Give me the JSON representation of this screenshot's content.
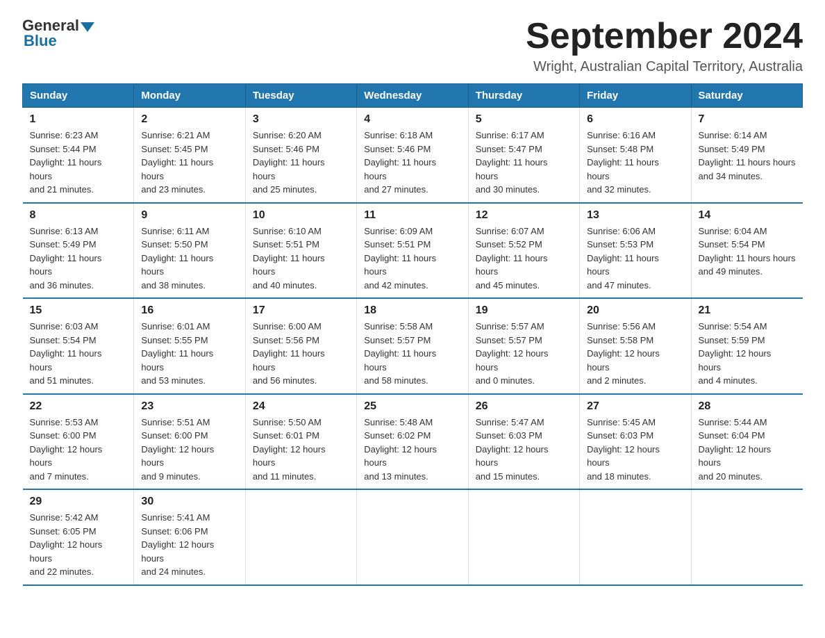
{
  "logo": {
    "general": "General",
    "blue": "Blue",
    "subtitle": "Blue"
  },
  "header": {
    "month_year": "September 2024",
    "location": "Wright, Australian Capital Territory, Australia"
  },
  "days_of_week": [
    "Sunday",
    "Monday",
    "Tuesday",
    "Wednesday",
    "Thursday",
    "Friday",
    "Saturday"
  ],
  "weeks": [
    [
      {
        "day": "1",
        "sunrise": "6:23 AM",
        "sunset": "5:44 PM",
        "daylight": "11 hours and 21 minutes."
      },
      {
        "day": "2",
        "sunrise": "6:21 AM",
        "sunset": "5:45 PM",
        "daylight": "11 hours and 23 minutes."
      },
      {
        "day": "3",
        "sunrise": "6:20 AM",
        "sunset": "5:46 PM",
        "daylight": "11 hours and 25 minutes."
      },
      {
        "day": "4",
        "sunrise": "6:18 AM",
        "sunset": "5:46 PM",
        "daylight": "11 hours and 27 minutes."
      },
      {
        "day": "5",
        "sunrise": "6:17 AM",
        "sunset": "5:47 PM",
        "daylight": "11 hours and 30 minutes."
      },
      {
        "day": "6",
        "sunrise": "6:16 AM",
        "sunset": "5:48 PM",
        "daylight": "11 hours and 32 minutes."
      },
      {
        "day": "7",
        "sunrise": "6:14 AM",
        "sunset": "5:49 PM",
        "daylight": "11 hours and 34 minutes."
      }
    ],
    [
      {
        "day": "8",
        "sunrise": "6:13 AM",
        "sunset": "5:49 PM",
        "daylight": "11 hours and 36 minutes."
      },
      {
        "day": "9",
        "sunrise": "6:11 AM",
        "sunset": "5:50 PM",
        "daylight": "11 hours and 38 minutes."
      },
      {
        "day": "10",
        "sunrise": "6:10 AM",
        "sunset": "5:51 PM",
        "daylight": "11 hours and 40 minutes."
      },
      {
        "day": "11",
        "sunrise": "6:09 AM",
        "sunset": "5:51 PM",
        "daylight": "11 hours and 42 minutes."
      },
      {
        "day": "12",
        "sunrise": "6:07 AM",
        "sunset": "5:52 PM",
        "daylight": "11 hours and 45 minutes."
      },
      {
        "day": "13",
        "sunrise": "6:06 AM",
        "sunset": "5:53 PM",
        "daylight": "11 hours and 47 minutes."
      },
      {
        "day": "14",
        "sunrise": "6:04 AM",
        "sunset": "5:54 PM",
        "daylight": "11 hours and 49 minutes."
      }
    ],
    [
      {
        "day": "15",
        "sunrise": "6:03 AM",
        "sunset": "5:54 PM",
        "daylight": "11 hours and 51 minutes."
      },
      {
        "day": "16",
        "sunrise": "6:01 AM",
        "sunset": "5:55 PM",
        "daylight": "11 hours and 53 minutes."
      },
      {
        "day": "17",
        "sunrise": "6:00 AM",
        "sunset": "5:56 PM",
        "daylight": "11 hours and 56 minutes."
      },
      {
        "day": "18",
        "sunrise": "5:58 AM",
        "sunset": "5:57 PM",
        "daylight": "11 hours and 58 minutes."
      },
      {
        "day": "19",
        "sunrise": "5:57 AM",
        "sunset": "5:57 PM",
        "daylight": "12 hours and 0 minutes."
      },
      {
        "day": "20",
        "sunrise": "5:56 AM",
        "sunset": "5:58 PM",
        "daylight": "12 hours and 2 minutes."
      },
      {
        "day": "21",
        "sunrise": "5:54 AM",
        "sunset": "5:59 PM",
        "daylight": "12 hours and 4 minutes."
      }
    ],
    [
      {
        "day": "22",
        "sunrise": "5:53 AM",
        "sunset": "6:00 PM",
        "daylight": "12 hours and 7 minutes."
      },
      {
        "day": "23",
        "sunrise": "5:51 AM",
        "sunset": "6:00 PM",
        "daylight": "12 hours and 9 minutes."
      },
      {
        "day": "24",
        "sunrise": "5:50 AM",
        "sunset": "6:01 PM",
        "daylight": "12 hours and 11 minutes."
      },
      {
        "day": "25",
        "sunrise": "5:48 AM",
        "sunset": "6:02 PM",
        "daylight": "12 hours and 13 minutes."
      },
      {
        "day": "26",
        "sunrise": "5:47 AM",
        "sunset": "6:03 PM",
        "daylight": "12 hours and 15 minutes."
      },
      {
        "day": "27",
        "sunrise": "5:45 AM",
        "sunset": "6:03 PM",
        "daylight": "12 hours and 18 minutes."
      },
      {
        "day": "28",
        "sunrise": "5:44 AM",
        "sunset": "6:04 PM",
        "daylight": "12 hours and 20 minutes."
      }
    ],
    [
      {
        "day": "29",
        "sunrise": "5:42 AM",
        "sunset": "6:05 PM",
        "daylight": "12 hours and 22 minutes."
      },
      {
        "day": "30",
        "sunrise": "5:41 AM",
        "sunset": "6:06 PM",
        "daylight": "12 hours and 24 minutes."
      },
      null,
      null,
      null,
      null,
      null
    ]
  ],
  "labels": {
    "sunrise": "Sunrise:",
    "sunset": "Sunset:",
    "daylight": "Daylight:"
  }
}
